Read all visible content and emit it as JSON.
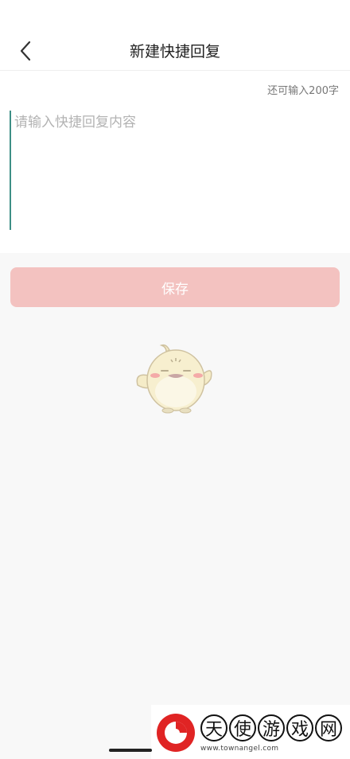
{
  "header": {
    "title": "新建快捷回复",
    "back_icon": "chevron-left-icon"
  },
  "editor": {
    "counter": "还可输入200字",
    "placeholder": "请输入快捷回复内容",
    "value": ""
  },
  "actions": {
    "save_label": "保存"
  },
  "watermark": {
    "chars": [
      "天",
      "使",
      "游",
      "戏",
      "网"
    ],
    "url": "www.townangel.com"
  },
  "colors": {
    "save_button": "#f3c2c0",
    "background": "#f8f8f8",
    "cursor": "#3e8f86"
  }
}
